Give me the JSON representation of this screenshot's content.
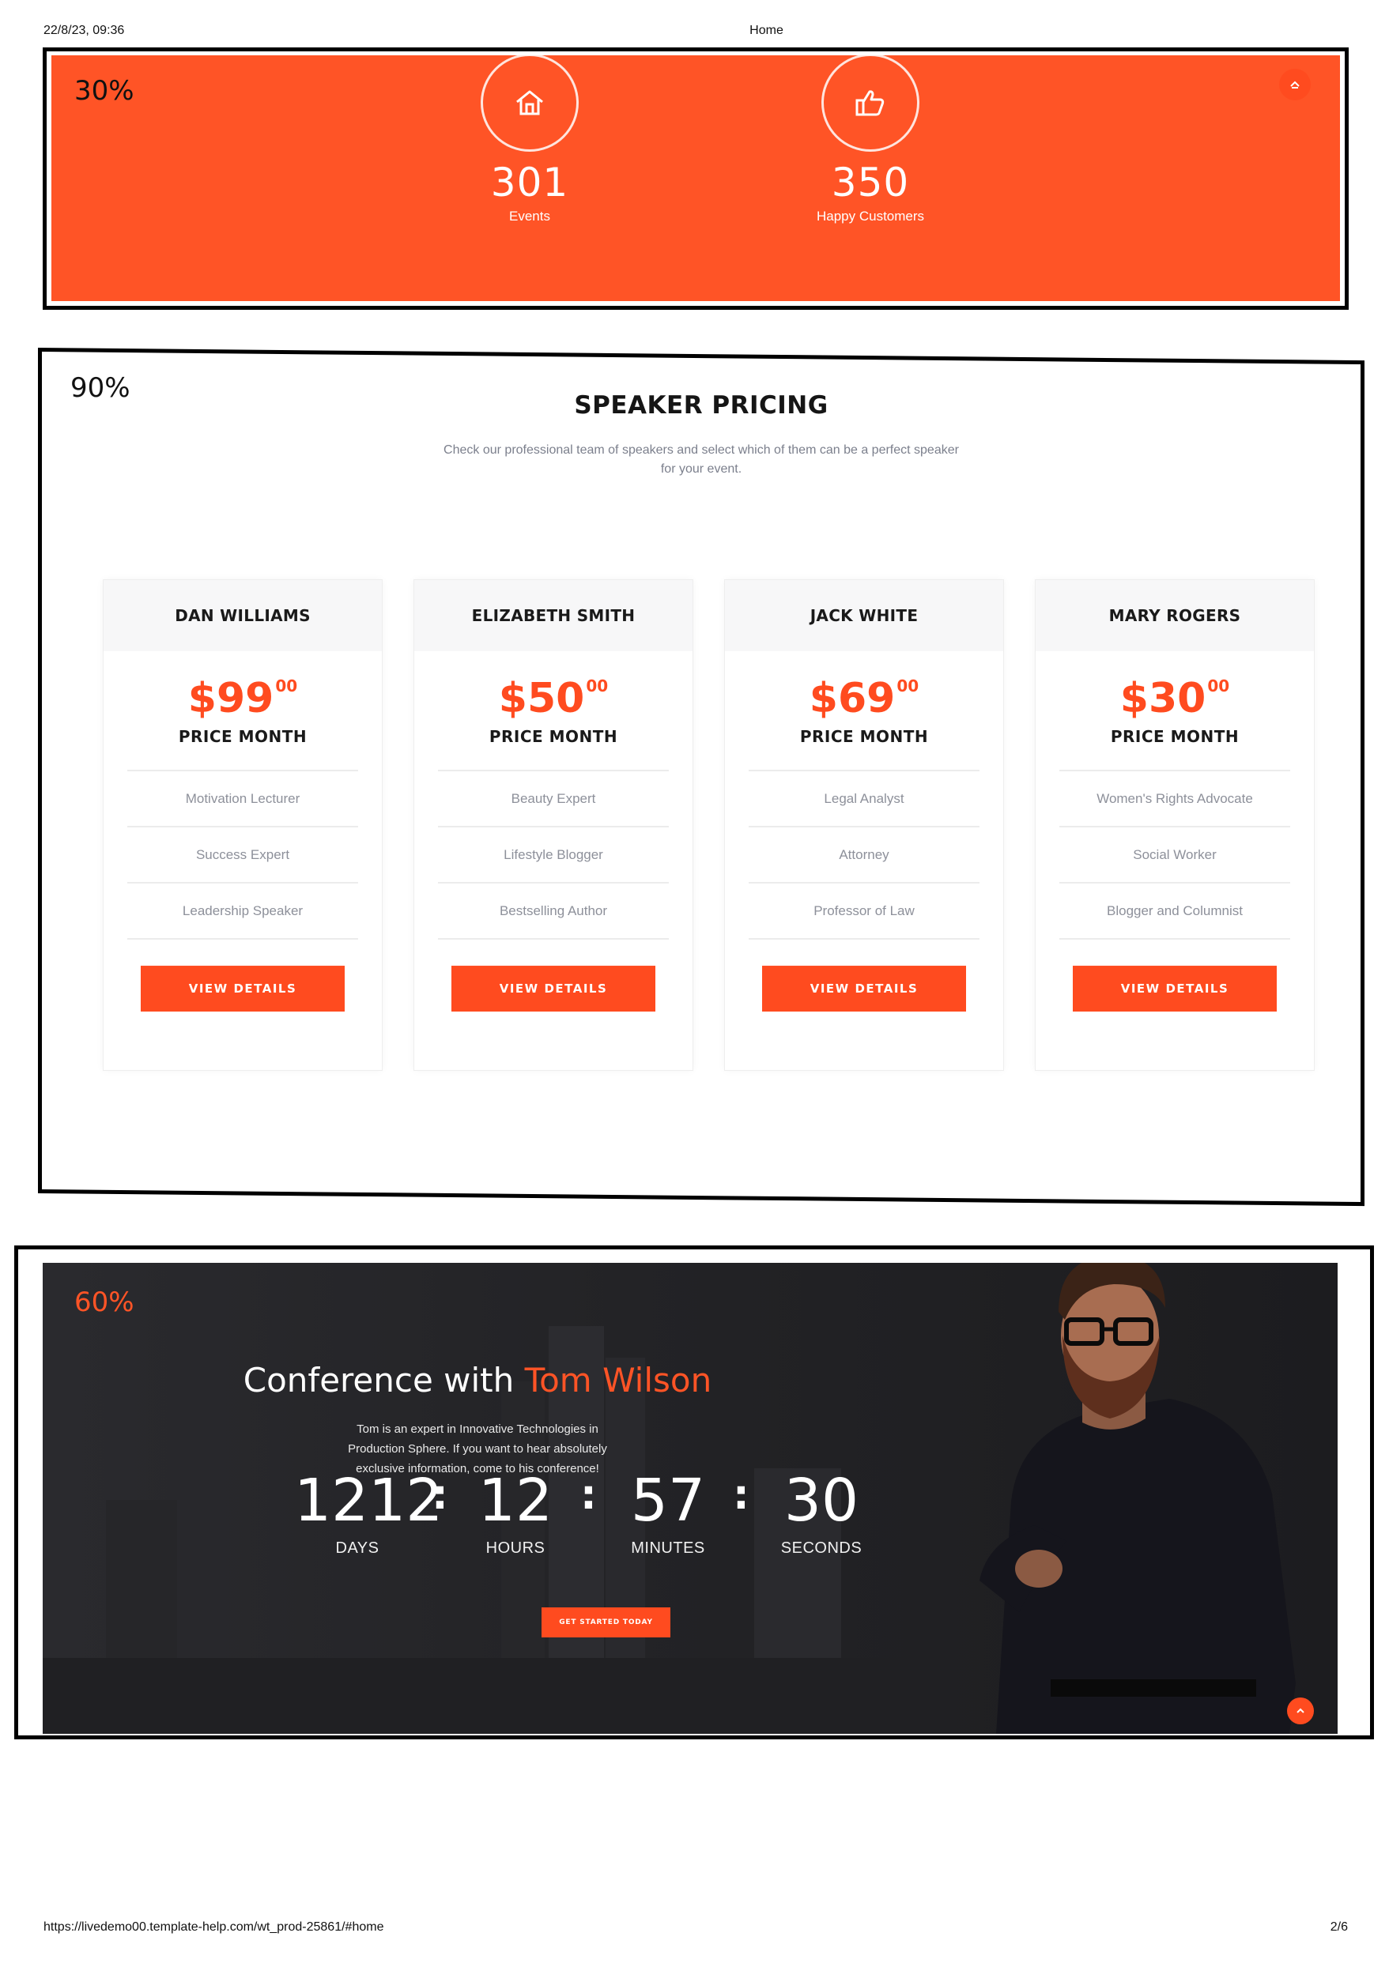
{
  "print": {
    "date_time": "22/8/23, 09:36",
    "page_title": "Home",
    "url": "https://livedemo00.template-help.com/wt_prod-25861/#home",
    "page_number": "2/6"
  },
  "zoom_labels": {
    "top": "30%",
    "middle": "90%",
    "bottom": "60%"
  },
  "colors": {
    "accent": "#ff5426",
    "dark": "#232326"
  },
  "stats": [
    {
      "icon": "home-icon",
      "value": "301",
      "label": "Events"
    },
    {
      "icon": "thumbs-up-icon",
      "value": "350",
      "label": "Happy Customers"
    }
  ],
  "pricing": {
    "title": "SPEAKER PRICING",
    "subtitle": "Check our professional team of speakers and select which of them can be a perfect speaker for your event.",
    "cards": [
      {
        "name": "DAN WILLIAMS",
        "price": "$99",
        "cents": "00",
        "caption": "PRICE MONTH",
        "features": [
          "Motivation Lecturer",
          "Success Expert",
          "Leadership Speaker"
        ],
        "button": "VIEW DETAILS"
      },
      {
        "name": "ELIZABETH SMITH",
        "price": "$50",
        "cents": "00",
        "caption": "PRICE MONTH",
        "features": [
          "Beauty Expert",
          "Lifestyle Blogger",
          "Bestselling Author"
        ],
        "button": "VIEW DETAILS"
      },
      {
        "name": "JACK WHITE",
        "price": "$69",
        "cents": "00",
        "caption": "PRICE MONTH",
        "features": [
          "Legal Analyst",
          "Attorney",
          "Professor of Law"
        ],
        "button": "VIEW DETAILS"
      },
      {
        "name": "MARY ROGERS",
        "price": "$30",
        "cents": "00",
        "caption": "PRICE MONTH",
        "features": [
          "Women's Rights Advocate",
          "Social Worker",
          "Blogger and Columnist"
        ],
        "button": "VIEW DETAILS"
      }
    ]
  },
  "conference": {
    "title_prefix": "Conference with ",
    "title_accent": "Tom Wilson",
    "description": "Tom is an expert in Innovative Technologies in Production Sphere. If you want to hear absolutely exclusive information, come to his conference!",
    "countdown": [
      {
        "value": "1212",
        "label": "DAYS"
      },
      {
        "value": "12",
        "label": "HOURS"
      },
      {
        "value": "57",
        "label": "MINUTES"
      },
      {
        "value": "30",
        "label": "SECONDS"
      }
    ],
    "separator": ":",
    "cta": "GET STARTED TODAY"
  }
}
